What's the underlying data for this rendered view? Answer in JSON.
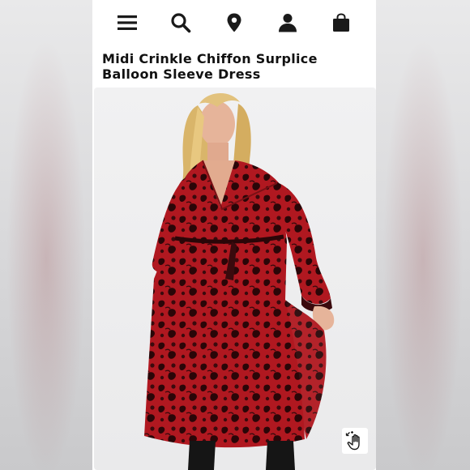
{
  "header": {
    "icons": [
      "menu-icon",
      "search-icon",
      "location-pin-icon",
      "account-icon",
      "shopping-bag-icon"
    ]
  },
  "product": {
    "title_line1": "Midi Crinkle Chiffon Surplice",
    "title_line2": "Balloon Sleeve Dress"
  },
  "image": {
    "zoom_icon": "zoom-hand-icon"
  },
  "colors": {
    "dress_red": "#b01820",
    "dress_dark": "#3a0a0d",
    "icon_dark": "#1a1a1a"
  }
}
